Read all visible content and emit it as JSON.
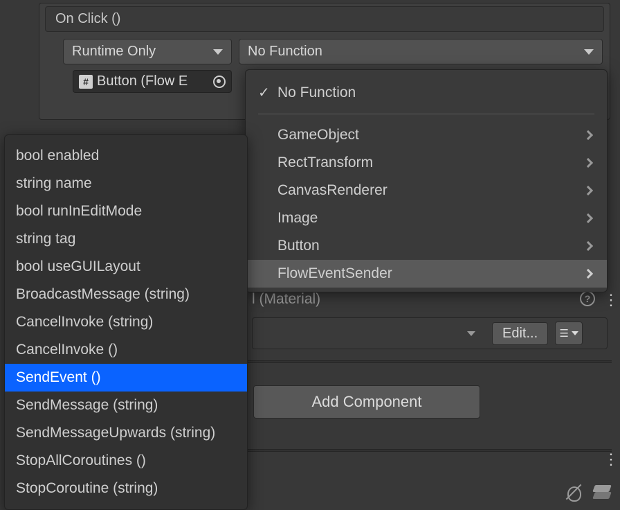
{
  "inspector": {
    "event_header": "On Click ()",
    "runtime_option": "Runtime Only",
    "function_option": "No Function",
    "object_ref": "Button (Flow E"
  },
  "function_menu": {
    "current": "No Function",
    "components": [
      "GameObject",
      "RectTransform",
      "CanvasRenderer",
      "Image",
      "Button",
      "FlowEventSender"
    ],
    "highlighted_index": 5
  },
  "method_menu": {
    "items": [
      "bool enabled",
      "string name",
      "bool runInEditMode",
      "string tag",
      "bool useGUILayout",
      "BroadcastMessage (string)",
      "CancelInvoke (string)",
      "CancelInvoke ()",
      "SendEvent ()",
      "SendMessage (string)",
      "SendMessageUpwards (string)",
      "StopAllCoroutines ()",
      "StopCoroutine (string)"
    ],
    "selected_index": 8
  },
  "material": {
    "header": "l (Material)",
    "edit_label": "Edit..."
  },
  "add_component_label": "Add Component"
}
